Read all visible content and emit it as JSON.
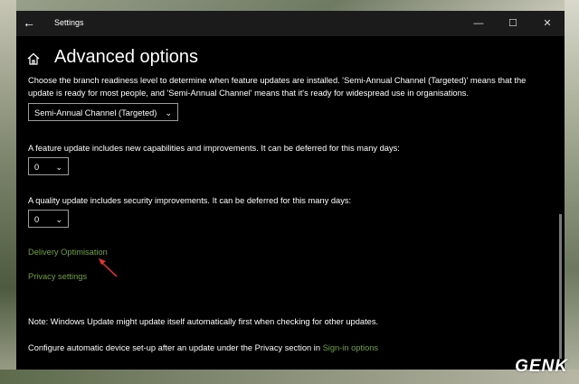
{
  "window": {
    "title": "Settings",
    "controls": {
      "minimize": "—",
      "maximize": "☐",
      "close": "✕"
    }
  },
  "header": {
    "title": "Advanced options"
  },
  "branch": {
    "description": "Choose the branch readiness level to determine when feature updates are installed. 'Semi-Annual Channel (Targeted)' means that the update is ready for most people, and 'Semi-Annual Channel' means that it's ready for widespread use in organisations.",
    "selected": "Semi-Annual Channel (Targeted)"
  },
  "feature_update": {
    "description": "A feature update includes new capabilities and improvements. It can be deferred for this many days:",
    "value": "0"
  },
  "quality_update": {
    "description": "A quality update includes security improvements. It can be deferred for this many days:",
    "value": "0"
  },
  "links": {
    "delivery_optimisation": "Delivery Optimisation",
    "privacy_settings": "Privacy settings"
  },
  "notes": {
    "update_note": "Note: Windows Update might update itself automatically first when checking for other updates.",
    "configure_prefix": "Configure automatic device set-up after an update under the Privacy section in ",
    "sign_in_link": "Sign-in options"
  },
  "watermark": "GENK",
  "colors": {
    "link": "#6ea33a",
    "background": "#000000",
    "arrow": "#e8322a"
  }
}
